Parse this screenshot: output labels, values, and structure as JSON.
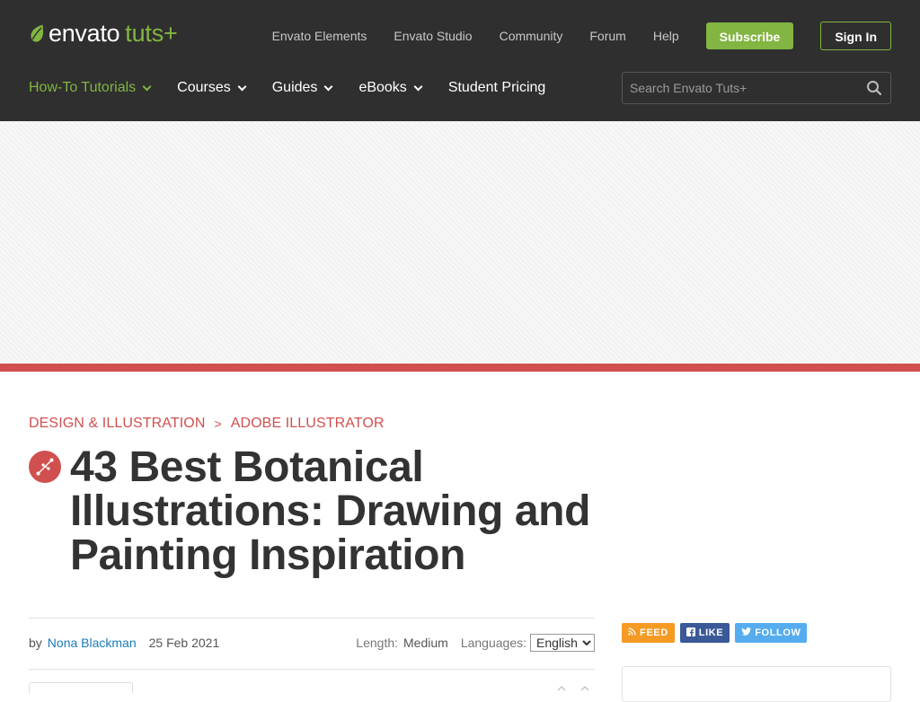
{
  "brand": {
    "envato": "envato",
    "tuts": "tuts+"
  },
  "toplinks": {
    "items": [
      {
        "label": "Envato Elements"
      },
      {
        "label": "Envato Studio"
      },
      {
        "label": "Community"
      },
      {
        "label": "Forum"
      },
      {
        "label": "Help"
      }
    ],
    "subscribe": "Subscribe",
    "signin": "Sign In"
  },
  "mainnav": {
    "items": [
      {
        "label": "How-To Tutorials",
        "dropdown": true,
        "active": true
      },
      {
        "label": "Courses",
        "dropdown": true
      },
      {
        "label": "Guides",
        "dropdown": true
      },
      {
        "label": "eBooks",
        "dropdown": true
      },
      {
        "label": "Student Pricing",
        "dropdown": false
      }
    ]
  },
  "search": {
    "placeholder": "Search Envato Tuts+",
    "icon": "search-icon"
  },
  "breadcrumb": {
    "category": "DESIGN & ILLUSTRATION",
    "separator": ">",
    "subcategory": "ADOBE ILLUSTRATOR"
  },
  "article": {
    "category_icon": "vector-pen-icon",
    "title": "43 Best Botanical Illustrations: Drawing and Painting Inspiration",
    "by": "by",
    "author": "Nona Blackman",
    "date": "25 Feb 2021",
    "length_label": "Length:",
    "length_value": "Medium",
    "languages_label": "Languages:",
    "language_selected": "English"
  },
  "social": {
    "feed": "FEED",
    "like": "LIKE",
    "follow": "FOLLOW"
  },
  "colors": {
    "header_bg": "#2f2f2f",
    "brand_green": "#82b541",
    "accent_red": "#d0504f",
    "link_blue": "#1a7bb9",
    "feed_orange": "#f59a23",
    "facebook_blue": "#3b5998",
    "twitter_blue": "#55acee"
  }
}
